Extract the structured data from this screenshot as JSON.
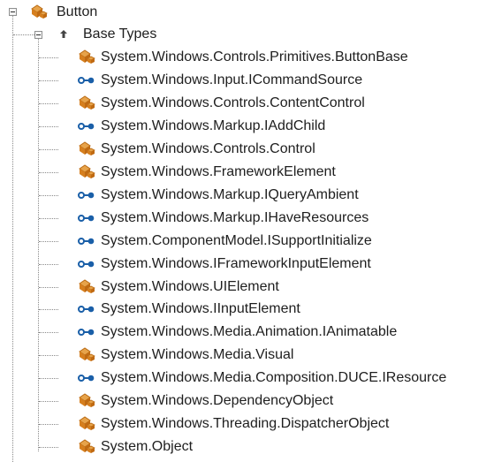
{
  "tree": {
    "root": {
      "label": "Button",
      "icon": "class-icon"
    },
    "group": {
      "label": "Base Types",
      "icon": "base-types-arrow-icon"
    },
    "items": [
      {
        "label": "System.Windows.Controls.Primitives.ButtonBase",
        "icon": "class-icon"
      },
      {
        "label": "System.Windows.Input.ICommandSource",
        "icon": "interface-icon"
      },
      {
        "label": "System.Windows.Controls.ContentControl",
        "icon": "class-icon"
      },
      {
        "label": "System.Windows.Markup.IAddChild",
        "icon": "interface-icon"
      },
      {
        "label": "System.Windows.Controls.Control",
        "icon": "class-icon"
      },
      {
        "label": "System.Windows.FrameworkElement",
        "icon": "class-icon"
      },
      {
        "label": "System.Windows.Markup.IQueryAmbient",
        "icon": "interface-icon"
      },
      {
        "label": "System.Windows.Markup.IHaveResources",
        "icon": "interface-icon"
      },
      {
        "label": "System.ComponentModel.ISupportInitialize",
        "icon": "interface-icon"
      },
      {
        "label": "System.Windows.IFrameworkInputElement",
        "icon": "interface-icon"
      },
      {
        "label": "System.Windows.UIElement",
        "icon": "class-icon"
      },
      {
        "label": "System.Windows.IInputElement",
        "icon": "interface-icon"
      },
      {
        "label": "System.Windows.Media.Animation.IAnimatable",
        "icon": "interface-icon"
      },
      {
        "label": "System.Windows.Media.Visual",
        "icon": "class-icon"
      },
      {
        "label": "System.Windows.Media.Composition.DUCE.IResource",
        "icon": "interface-icon"
      },
      {
        "label": "System.Windows.DependencyObject",
        "icon": "class-icon"
      },
      {
        "label": "System.Windows.Threading.DispatcherObject",
        "icon": "class-icon"
      },
      {
        "label": "System.Object",
        "icon": "class-icon"
      }
    ]
  },
  "colors": {
    "class_icon": "#d67f1e",
    "interface_icon": "#1a5fa8",
    "tree_line": "#8a8a8a"
  }
}
